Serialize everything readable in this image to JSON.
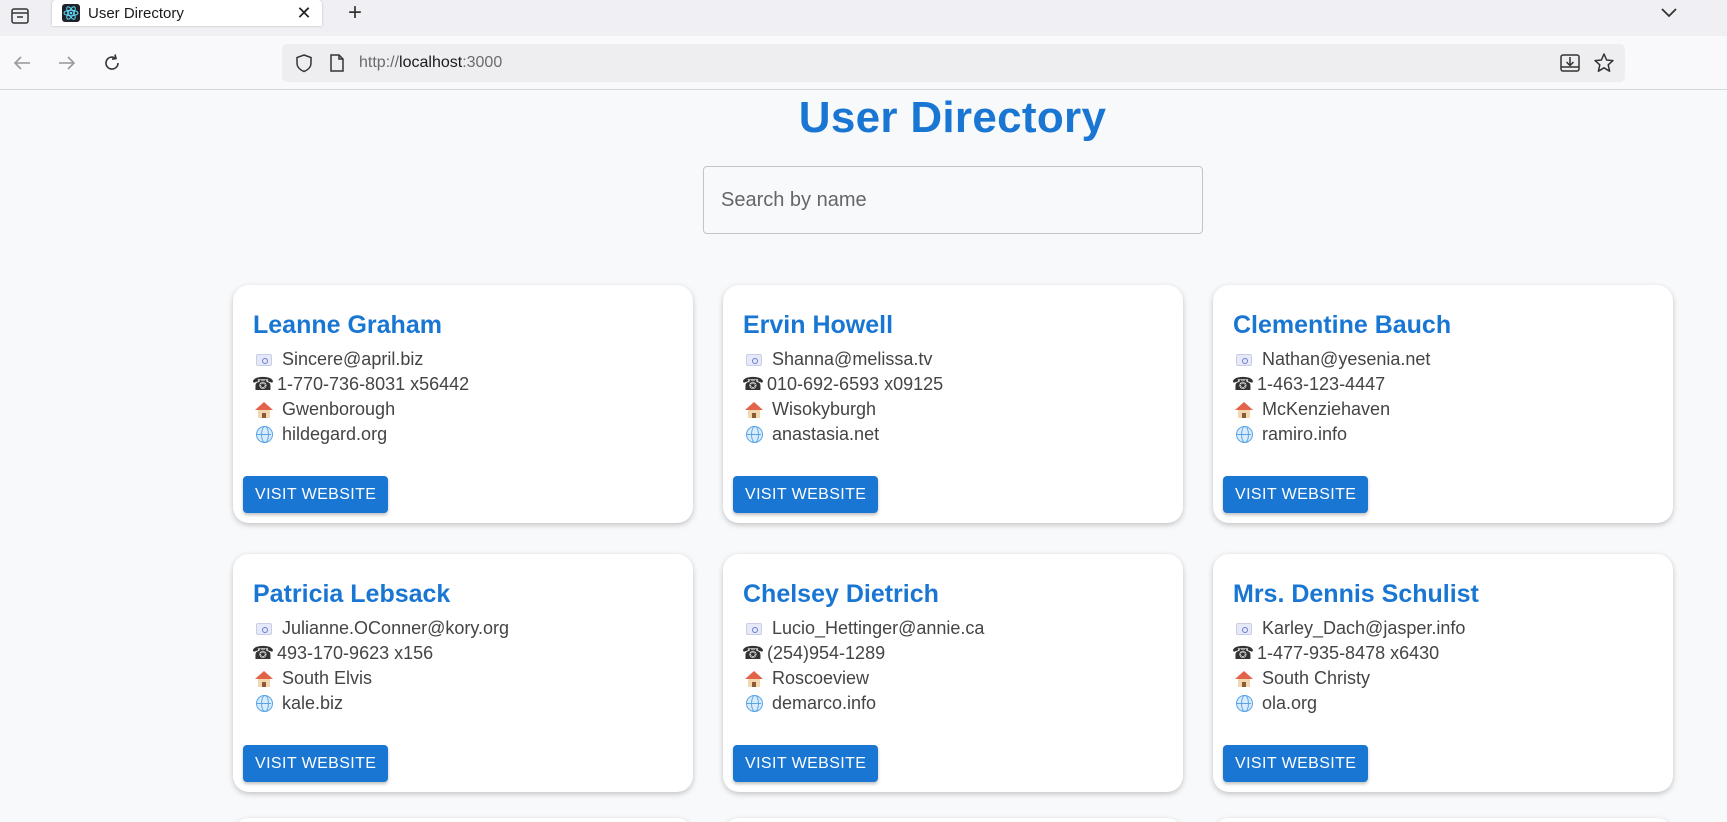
{
  "browser": {
    "tab_title": "User Directory",
    "url_scheme": "http://",
    "url_host": "localhost",
    "url_port": ":3000"
  },
  "page": {
    "heading": "User Directory",
    "search_placeholder": "Search by name"
  },
  "users": [
    {
      "name": "Leanne Graham",
      "email": "Sincere@april.biz",
      "phone": "1-770-736-8031 x56442",
      "city": "Gwenborough",
      "website": "hildegard.org",
      "button": "VISIT WEBSITE"
    },
    {
      "name": "Ervin Howell",
      "email": "Shanna@melissa.tv",
      "phone": "010-692-6593 x09125",
      "city": "Wisokyburgh",
      "website": "anastasia.net",
      "button": "VISIT WEBSITE"
    },
    {
      "name": "Clementine Bauch",
      "email": "Nathan@yesenia.net",
      "phone": "1-463-123-4447",
      "city": "McKenziehaven",
      "website": "ramiro.info",
      "button": "VISIT WEBSITE"
    },
    {
      "name": "Patricia Lebsack",
      "email": "Julianne.OConner@kory.org",
      "phone": "493-170-9623 x156",
      "city": "South Elvis",
      "website": "kale.biz",
      "button": "VISIT WEBSITE"
    },
    {
      "name": "Chelsey Dietrich",
      "email": "Lucio_Hettinger@annie.ca",
      "phone": "(254)954-1289",
      "city": "Roscoeview",
      "website": "demarco.info",
      "button": "VISIT WEBSITE"
    },
    {
      "name": "Mrs. Dennis Schulist",
      "email": "Karley_Dach@jasper.info",
      "phone": "1-477-935-8478 x6430",
      "city": "South Christy",
      "website": "ola.org",
      "button": "VISIT WEBSITE"
    }
  ],
  "icons": {
    "email": "envelope-icon",
    "phone": "telephone-icon",
    "city": "house-icon",
    "website": "globe-icon"
  },
  "colors": {
    "accent": "#1976d2",
    "background": "#f8f9fb"
  }
}
